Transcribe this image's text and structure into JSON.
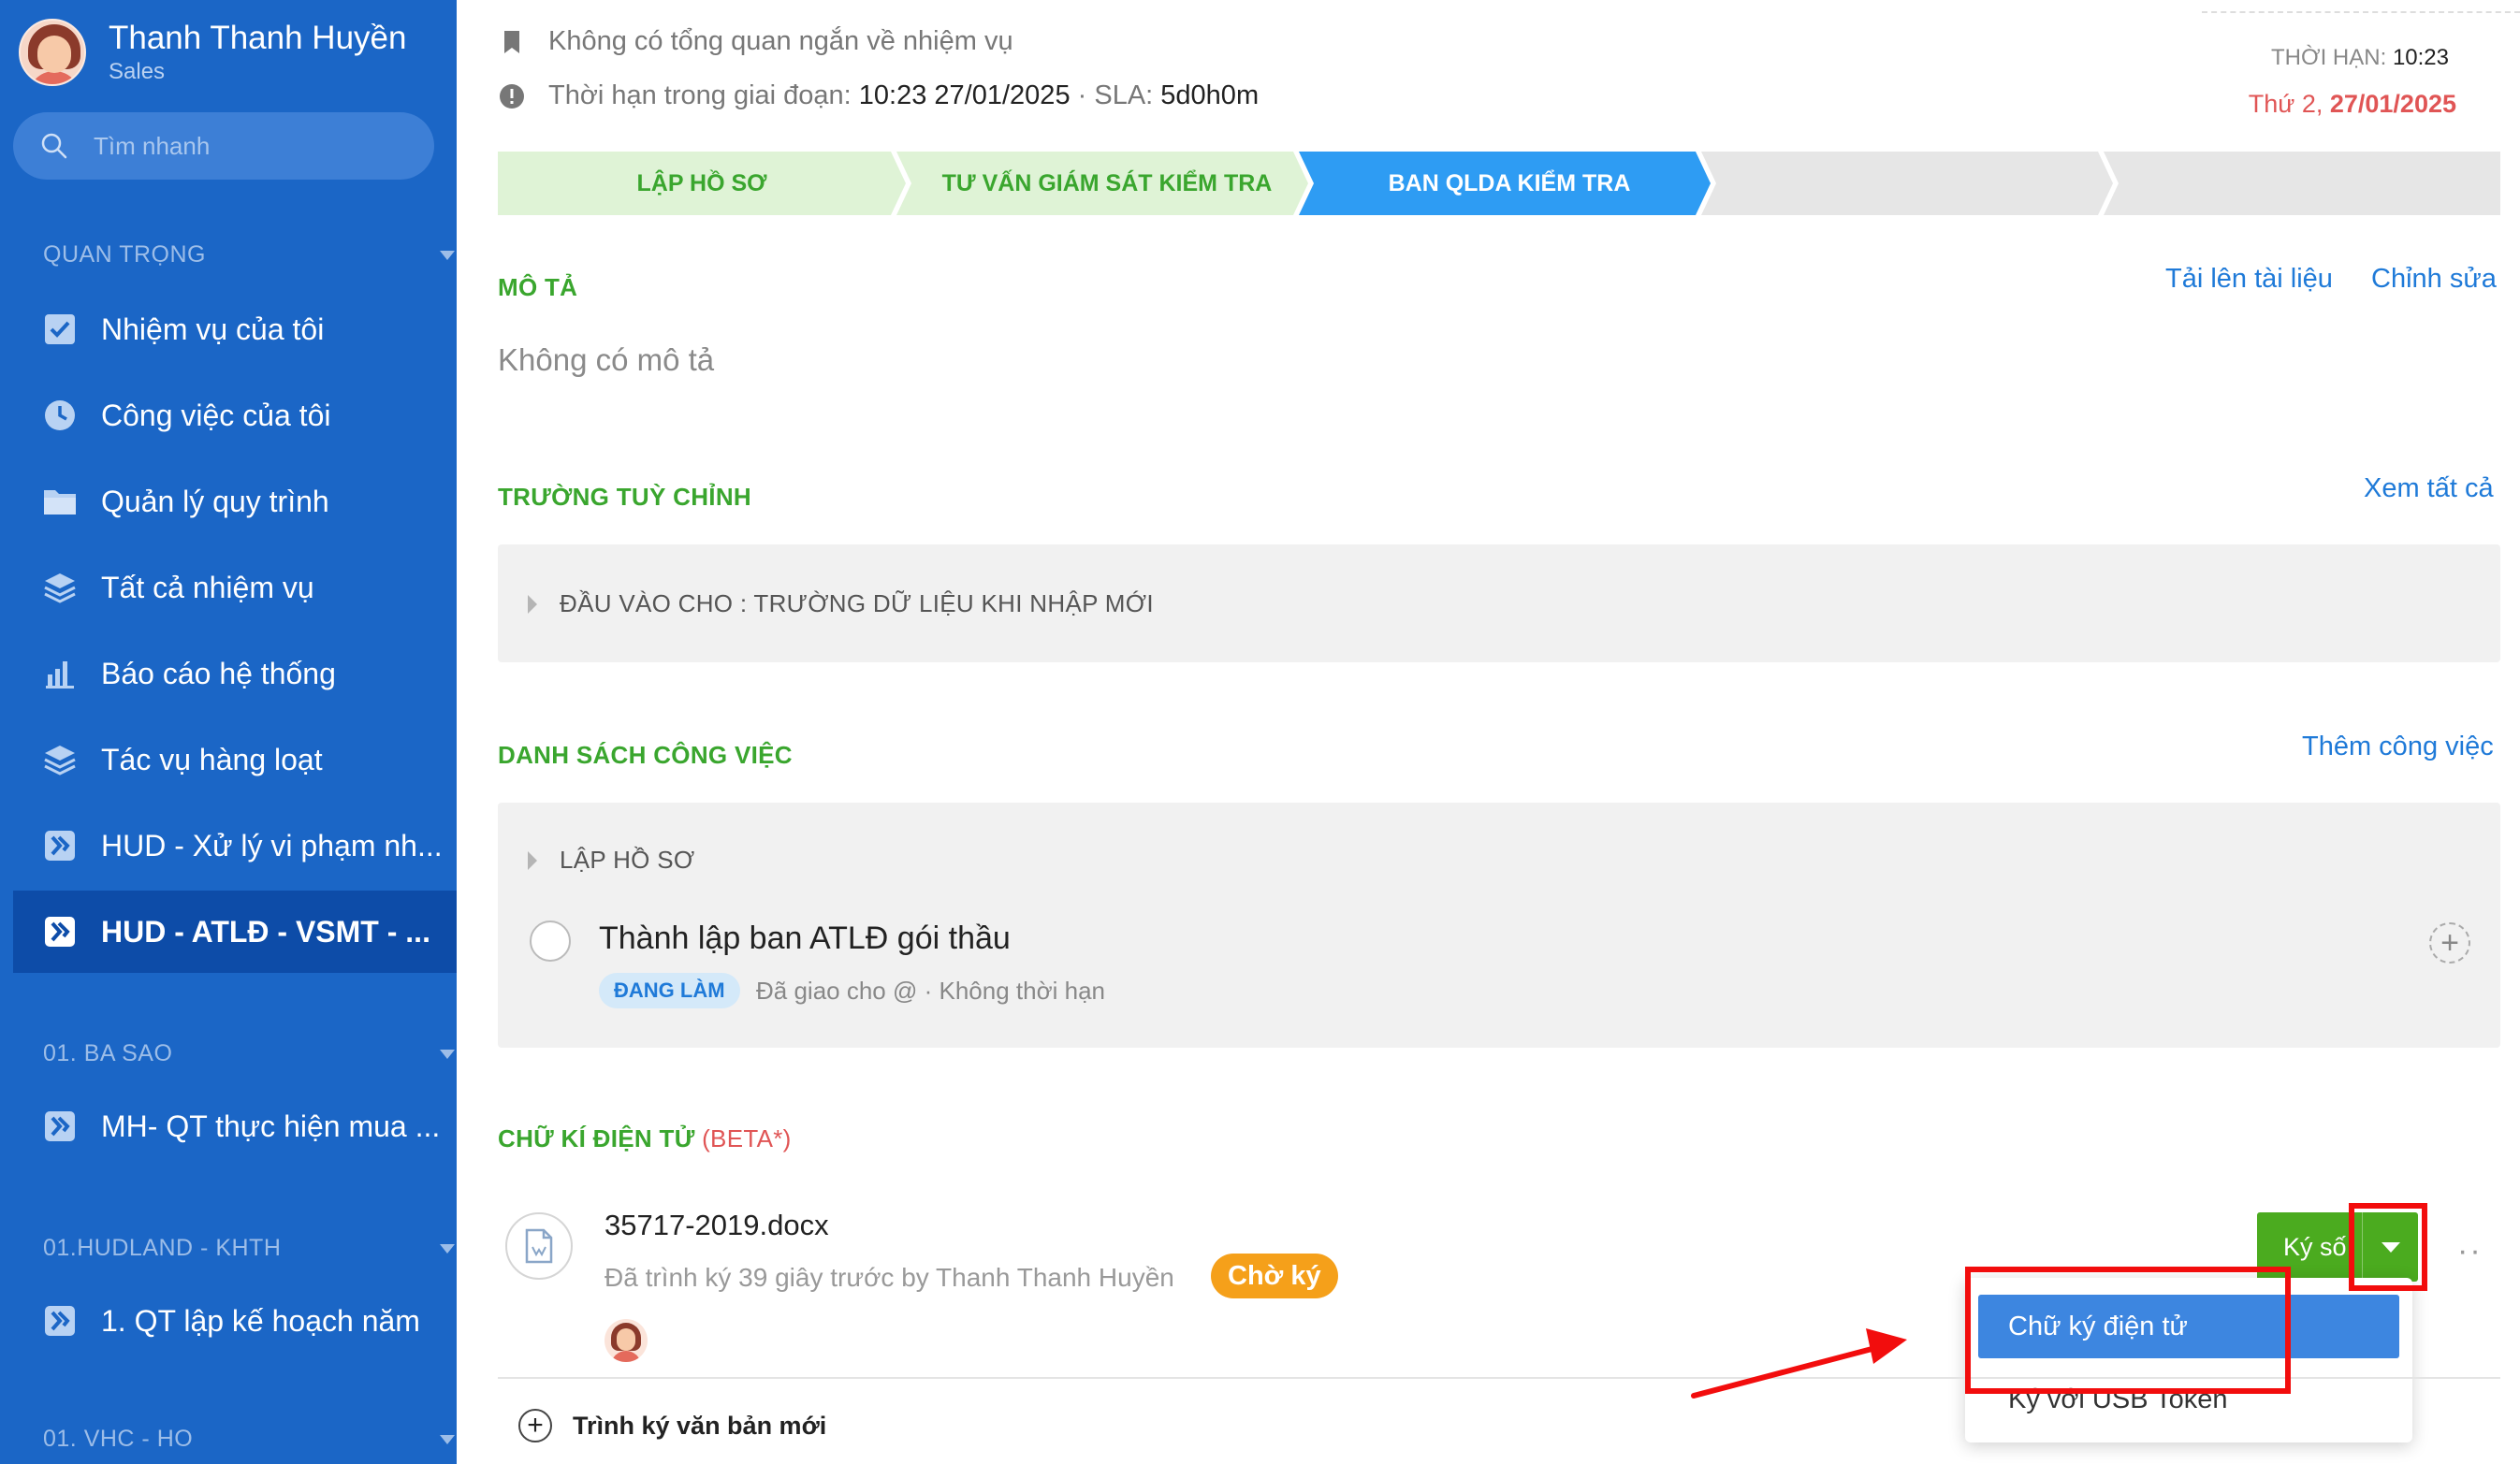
{
  "user": {
    "name": "Thanh Thanh Huyền",
    "role": "Sales"
  },
  "search": {
    "placeholder": "Tìm nhanh"
  },
  "sidebar": {
    "section_important": "QUAN TRỌNG",
    "items": [
      {
        "label": "Nhiệm vụ của tôi",
        "icon": "checkbox-icon"
      },
      {
        "label": "Công việc của tôi",
        "icon": "clock-icon"
      },
      {
        "label": "Quản lý quy trình",
        "icon": "folder-icon"
      },
      {
        "label": "Tất cả nhiệm vụ",
        "icon": "layers-icon"
      },
      {
        "label": "Báo cáo hệ thống",
        "icon": "bar-chart-icon"
      },
      {
        "label": "Tác vụ hàng loạt",
        "icon": "layers-icon"
      },
      {
        "label": "HUD - Xử lý vi phạm nh...",
        "icon": "workflow-icon"
      },
      {
        "label": "HUD - ATLĐ - VSMT - ...",
        "icon": "workflow-icon",
        "active": true
      }
    ],
    "section_basao": "01. BA SAO",
    "basao_items": [
      {
        "label": "MH- QT thực hiện mua ...",
        "icon": "workflow-icon"
      }
    ],
    "section_hudland": "01.HUDLAND - KHTH",
    "hudland_items": [
      {
        "label": "1. QT lập kế hoạch năm",
        "icon": "workflow-icon"
      }
    ],
    "section_vhc": "01. VHC - HO"
  },
  "header": {
    "no_overview": "Không có tổng quan ngắn về nhiệm vụ",
    "stage_deadline_label": "Thời hạn trong giai đoạn:",
    "stage_deadline_value": "10:23 27/01/2025",
    "sla_label": "· SLA:",
    "sla_value": "5d0h0m",
    "deadline_label": "THỜI HẠN:",
    "deadline_time": "10:23",
    "deadline_weekday": "Thứ 2,",
    "deadline_date": "27/01/2025"
  },
  "stages": [
    "LẬP HỒ SƠ",
    "TƯ VẤN GIÁM SÁT KIỂM TRA",
    "BAN QLDA KIỂM TRA",
    "",
    ""
  ],
  "description": {
    "title": "MÔ TẢ",
    "upload_link": "Tải lên tài liệu",
    "edit_link": "Chỉnh sửa",
    "empty_text": "Không có mô tả"
  },
  "custom_fields": {
    "title": "TRƯỜNG TUỲ CHỈNH",
    "view_all_link": "Xem tất cả",
    "group_label": "ĐẦU VÀO CHO : TRƯỜNG DỮ LIỆU KHI NHẬP MỚI"
  },
  "task_list": {
    "title": "DANH SÁCH CÔNG VIỆC",
    "add_link": "Thêm công việc",
    "group_label": "LẬP HỒ SƠ",
    "task": {
      "title": "Thành lập ban ATLĐ gói thầu",
      "status": "ĐANG LÀM",
      "meta": "Đã giao cho @ · Không thời hạn"
    }
  },
  "esign": {
    "title": "CHỮ KÍ ĐIỆN TỬ",
    "beta": "(BETA*)",
    "document": {
      "name": "35717-2019.docx",
      "meta": "Đã trình ký 39 giây trước by Thanh Thanh Huyền",
      "status": "Chờ ký"
    },
    "sign_button": "Ký số",
    "dropdown": [
      "Chữ ký điện tử",
      "Ký với USB Token"
    ],
    "new_doc": "Trình ký văn bản mới"
  },
  "colors": {
    "sidebar_bg": "#1b66c6",
    "accent_green": "#3aa62e",
    "link_blue": "#1f7ad8",
    "stage_done": "#dff3d6",
    "stage_current": "#2e9cf3",
    "stage_pending": "#e6e6e6",
    "annotation_red": "#f20d0d"
  }
}
